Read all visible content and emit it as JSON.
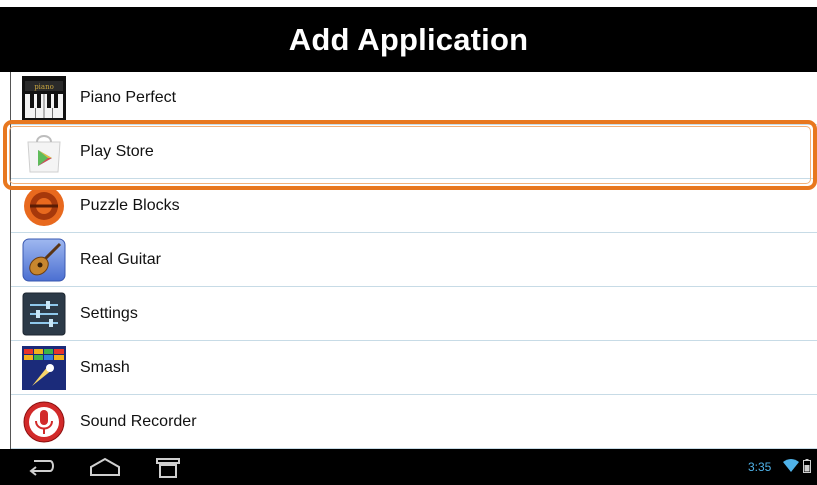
{
  "header": {
    "title": "Add Application"
  },
  "apps": [
    {
      "label": "Piano Perfect",
      "icon": "piano-icon"
    },
    {
      "label": "Play Store",
      "icon": "play-store-icon"
    },
    {
      "label": "Puzzle Blocks",
      "icon": "puzzle-blocks-icon"
    },
    {
      "label": "Real Guitar",
      "icon": "guitar-icon"
    },
    {
      "label": "Settings",
      "icon": "settings-icon"
    },
    {
      "label": "Smash",
      "icon": "smash-icon"
    },
    {
      "label": "Sound Recorder",
      "icon": "microphone-icon"
    }
  ],
  "highlighted_item": "Play Store",
  "colors": {
    "highlight": "#e8771e",
    "header_bg": "#000000",
    "clock": "#4fb2e8"
  },
  "navbar": {
    "buttons": [
      "back-icon",
      "home-icon",
      "recent-apps-icon"
    ],
    "clock": "3:35"
  },
  "status_icons": [
    "wifi-icon",
    "battery-icon"
  ]
}
